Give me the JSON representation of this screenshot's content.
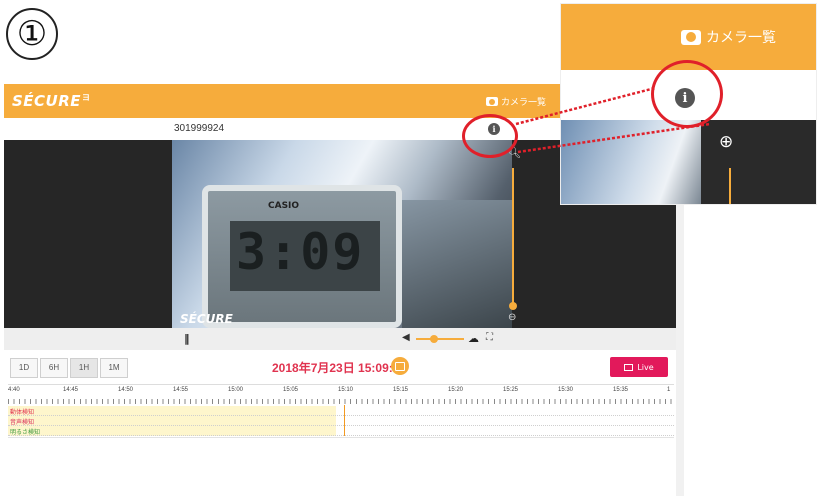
{
  "step_marker": "①",
  "app": {
    "logo": "SÉCURE",
    "logo_sup": "ヨ",
    "header_camlist_label": "カメラ一覧",
    "device_id": "301999924",
    "video_watermark": "SÉCURE",
    "clock_brand": "CASIO",
    "clock_digits": "3:09",
    "range_buttons": [
      "1D",
      "6H",
      "1H",
      "1M"
    ],
    "datetime": "2018年7月23日 15:09:39",
    "live_label": "Live",
    "timeline_ticks": [
      "4:40",
      "14:45",
      "14:50",
      "14:55",
      "15:00",
      "15:05",
      "15:10",
      "15:15",
      "15:20",
      "15:25",
      "15:30",
      "15:35",
      "1"
    ],
    "tracks": [
      {
        "label": "動体検知",
        "color": "#e0334f"
      },
      {
        "label": "音声検知",
        "color": "#d9305a"
      },
      {
        "label": "明るさ検知",
        "color": "#3f9a3f"
      }
    ]
  },
  "callout": {
    "camlist_label": "カメラ一覧"
  },
  "icons": {
    "camera": "camera-icon",
    "info": "info-icon",
    "zoom_in": "zoom-in-icon",
    "zoom_out": "zoom-out-icon",
    "pause": "pause-icon",
    "volume": "volume-icon",
    "cloud": "cloud-download-icon",
    "fullscreen": "fullscreen-icon",
    "calendar": "calendar-icon",
    "live": "live-icon"
  },
  "colors": {
    "brand_orange": "#f6ac3c",
    "live_pink": "#e2195b",
    "datetime_red": "#e0334f",
    "highlight_red": "#e0202a",
    "detection_band": "#fef6cc"
  }
}
